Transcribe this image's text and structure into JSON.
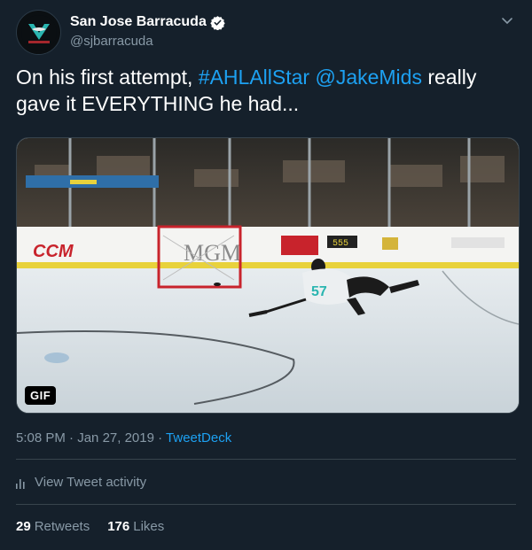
{
  "header": {
    "display_name": "San Jose Barracuda",
    "handle": "@sjbarracuda",
    "verified_icon": "verified-badge-icon",
    "menu_icon": "chevron-down-icon"
  },
  "tweet": {
    "text_before": "On his first attempt, ",
    "hashtag": "#AHLAllStar",
    "text_between": " ",
    "mention": "@JakeMids",
    "text_after": " really gave it EVERYTHING he had..."
  },
  "media": {
    "badge": "GIF",
    "board_sponsor_1": "CCM",
    "board_sponsor_2": "MGM",
    "jersey_number": "57",
    "scoreboard": "555",
    "colors": {
      "ice": "#dfe6ea",
      "boards_stripe": "#e8d23c",
      "accent": "#1da1f2"
    }
  },
  "meta": {
    "time": "5:08 PM",
    "separator": " · ",
    "date": "Jan 27, 2019",
    "separator2": " · ",
    "source": "TweetDeck"
  },
  "activity": {
    "label": "View Tweet activity"
  },
  "stats": {
    "retweets_count": "29",
    "retweets_label": "Retweets",
    "likes_count": "176",
    "likes_label": "Likes"
  }
}
